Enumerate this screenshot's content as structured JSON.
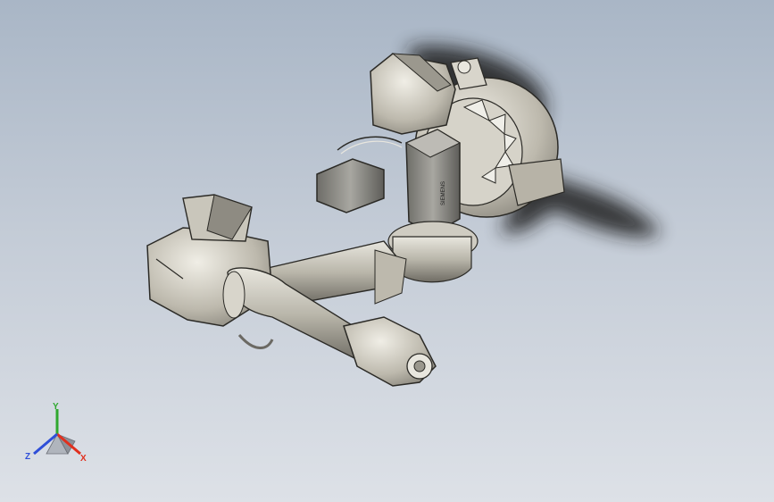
{
  "scene": {
    "subject": "robot-arm-assembly-model",
    "background_top": "#a9b6c6",
    "background_bottom": "#dde1e7",
    "metal_color": "#c7c4b8",
    "metal_shade": "#8d8a80",
    "edge_color": "#2b2a26",
    "motor_color": "#8e8d88",
    "motor_label": "SIEMENS"
  },
  "triad": {
    "x_label": "X",
    "y_label": "Y",
    "z_label": "Z",
    "x_color": "#e0301e",
    "y_color": "#2fa82f",
    "z_color": "#2f4fd8"
  }
}
